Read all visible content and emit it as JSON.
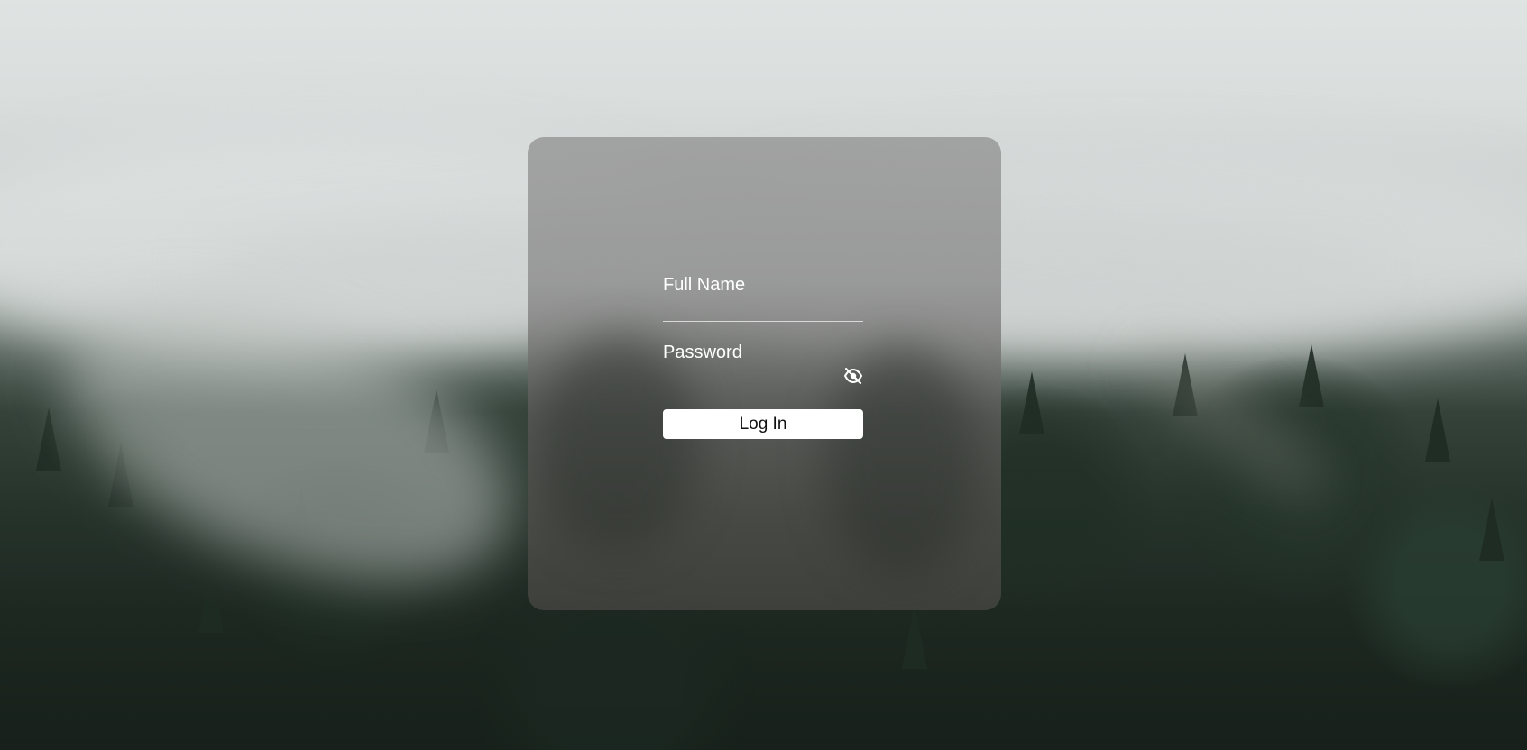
{
  "form": {
    "full_name": {
      "label": "Full Name",
      "value": ""
    },
    "password": {
      "label": "Password",
      "value": "",
      "toggle_icon": "eye-off-icon"
    },
    "login_label": "Log In"
  },
  "colors": {
    "card_tint": "#8c8c8c",
    "text": "#ffffff",
    "button_bg": "#ffffff",
    "button_text": "#111111"
  }
}
